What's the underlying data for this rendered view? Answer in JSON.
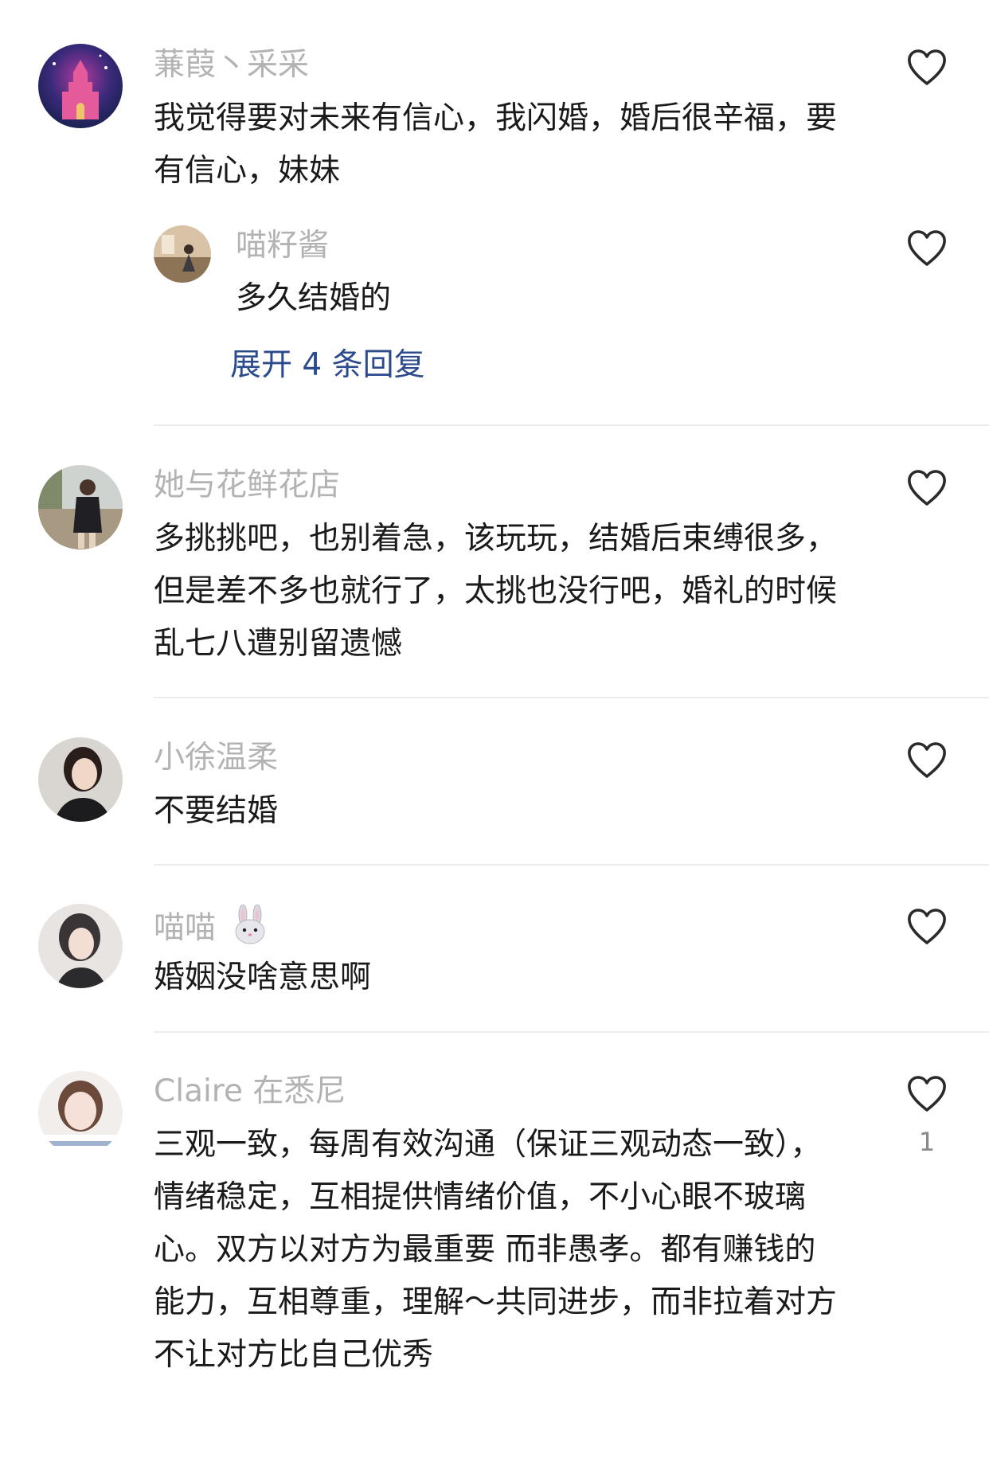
{
  "comments": [
    {
      "username": "蒹葭丶采采",
      "content": "我觉得要对未来有信心，我闪婚，婚后很辛福，要有信心，妹妹",
      "reply": {
        "username": "喵籽酱",
        "content": "多久结婚的"
      },
      "expand_label": "展开 4 条回复"
    },
    {
      "username": "她与花鲜花店",
      "content": "多挑挑吧，也别着急，该玩玩，结婚后束缚很多，但是差不多也就行了，太挑也没行吧，婚礼的时候乱七八遭别留遗憾"
    },
    {
      "username": "小徐温柔",
      "content": "不要结婚"
    },
    {
      "username": "喵喵",
      "content": "婚姻没啥意思啊"
    },
    {
      "username": "Claire 在悉尼",
      "content": "三观一致，每周有效沟通（保证三观动态一致），情绪稳定，互相提供情绪价值，不小心眼不玻璃心。双方以对方为最重要 而非愚孝。都有赚钱的能力，互相尊重，理解～共同进步，而非拉着对方不让对方比自己优秀",
      "likes": "1"
    }
  ],
  "icons": {
    "like": "heart-outline-icon",
    "emoji": "rabbit-face-icon"
  },
  "colors": {
    "username": "#b3b3b3",
    "content": "#1a1a1a",
    "expand": "#2b4b8c",
    "divider": "#ececec"
  }
}
